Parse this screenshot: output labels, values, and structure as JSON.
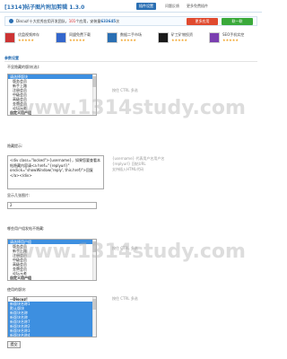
{
  "header": {
    "title": "[1314]帖子图片附加剪辑 1.3.0",
    "tabs": [
      {
        "label": "插件设置",
        "active": true
      },
      {
        "label": "问题反馈",
        "active": false
      },
      {
        "label": "更多免费插件",
        "active": false
      }
    ]
  },
  "banner": {
    "text_prefix": "Discuz!十大优秀应用开发团队，",
    "highlight": "101",
    "text_mid": "个应用，安装量",
    "count": "633645",
    "text_suffix": "次",
    "btn_more": "更多应用",
    "btn_contact": "联一联"
  },
  "apps": [
    {
      "name": "优盘视频库存",
      "stars": "★★★★★",
      "icon_color": "#cc3333"
    },
    {
      "name": "同盟免费下载",
      "stars": "★★★★★",
      "icon_color": "#3366cc"
    },
    {
      "name": "数据二手市场",
      "stars": "★★★★★",
      "icon_color": "#2a6fb3"
    },
    {
      "name": "矿工矿物投资",
      "stars": "★★★★★",
      "icon_color": "#1a1a1a"
    },
    {
      "name": "SEO手机实控",
      "stars": "★★★★★",
      "icon_color": "#7a3fb0"
    }
  ],
  "section_title": "参数设置",
  "fields": {
    "forum_label": "不显隐藏的版块(选):",
    "forum_hint": "按住 CTRL 多选",
    "forum_options": [
      {
        "label": "请选择版块",
        "type": "sel"
      },
      {
        "label": "版务会员",
        "type": "ind"
      },
      {
        "label": "新手上路",
        "type": "ind"
      },
      {
        "label": "注册会员",
        "type": "ind"
      },
      {
        "label": "中级会员",
        "type": "ind"
      },
      {
        "label": "高级会员",
        "type": "ind"
      },
      {
        "label": "金牌会员",
        "type": "ind"
      },
      {
        "label": "论坛元老",
        "type": "ind"
      },
      {
        "label": "自定义用户组",
        "type": "grp"
      }
    ],
    "template_label": "隐藏提示:",
    "template_value": "<div class=\"locked\">{username}，如果您要查看本帖隐藏内容请<a href=\"{replyurl}\" onclick=\"showWindow('reply', this.href)\">回复</a></div>",
    "template_hint_1": "{username} 代表用户名用户名",
    "template_hint_2": "{replyurl} 回帖URL",
    "template_hint_3": "支持插入HTML代码",
    "count_label": "显示几张图片:",
    "count_value": "2",
    "group_label": "哪些用户组发帖不隐藏:",
    "group_hint": "按住 CTRL 多选",
    "group_options": [
      {
        "label": "请选择用户组",
        "type": "sel"
      },
      {
        "label": "版务会员",
        "type": "ind"
      },
      {
        "label": "新手上路",
        "type": "ind"
      },
      {
        "label": "注册会员",
        "type": "ind"
      },
      {
        "label": "中级会员",
        "type": "ind"
      },
      {
        "label": "高级会员",
        "type": "ind"
      },
      {
        "label": "金牌会员",
        "type": "ind"
      },
      {
        "label": "论坛元老",
        "type": "ind"
      },
      {
        "label": "自定义用户组",
        "type": "grp"
      }
    ],
    "board_label": "使用的版块:",
    "board_hint": "按住 CTRL 多选",
    "board_options": [
      {
        "label": "--Discuz!",
        "type": "grp"
      },
      {
        "label": "新版块名称1",
        "type": "sel"
      },
      {
        "label": "默认版块",
        "type": "sel"
      },
      {
        "label": "新版块名称",
        "type": "sel"
      },
      {
        "label": "新版块名称",
        "type": "sel"
      },
      {
        "label": "新版块名称7",
        "type": "sel"
      },
      {
        "label": "新版块名称2",
        "type": "sel"
      },
      {
        "label": "新版块名称3",
        "type": "sel"
      },
      {
        "label": "新版块名称4",
        "type": "sel"
      },
      {
        "label": "新版块名称5",
        "type": "sel"
      }
    ],
    "submit_label": "提交"
  },
  "watermark": "www.1314study.com"
}
